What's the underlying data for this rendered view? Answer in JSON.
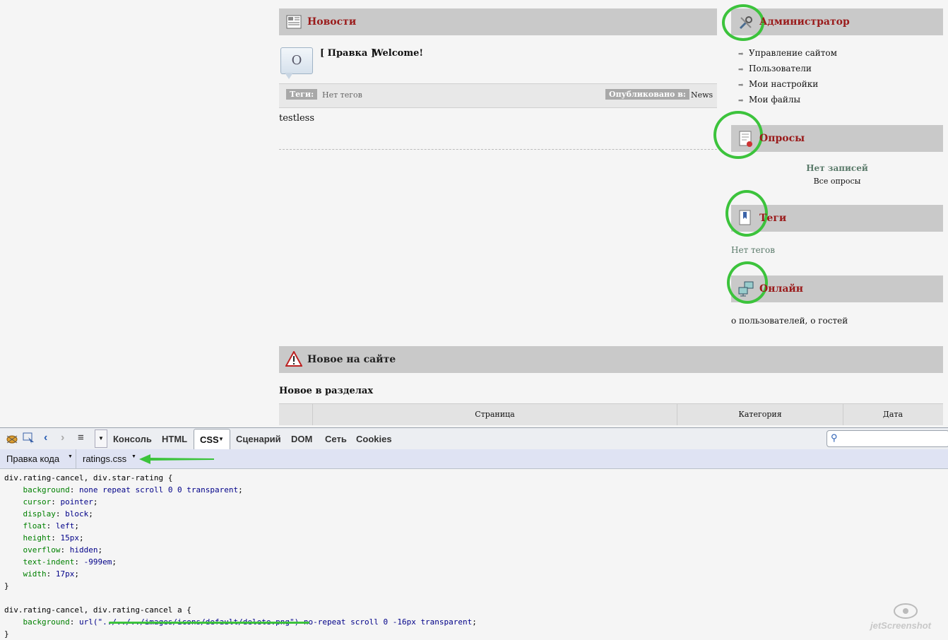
{
  "news": {
    "title": "Новости",
    "avatar_letter": "O",
    "edit_label": "[ Правка ]",
    "post_title": "Welcome!",
    "tags_label": "Теги:",
    "tags_value": "Нет тегов",
    "published_label": "Опубликовано в:",
    "published_value": "News",
    "body": "testless"
  },
  "admin": {
    "title": "Администратор",
    "links": [
      "Управление сайтом",
      "Пользователи",
      "Мои настройки",
      "Мои файлы"
    ]
  },
  "polls": {
    "title": "Опросы",
    "empty": "Нет записей",
    "all": "Все опросы"
  },
  "tags": {
    "title": "Теги",
    "empty": "Нет тегов"
  },
  "online": {
    "title": "Онлайн",
    "text": "о пользователей, о гостей"
  },
  "new_on_site": {
    "title": "Новое на сайте",
    "subtitle": "Новое в разделах",
    "columns": [
      "Страница",
      "Категория",
      "Дата"
    ]
  },
  "firebug": {
    "tabs": [
      "Консоль",
      "HTML",
      "CSS",
      "Сценарий",
      "DOM",
      "Сеть",
      "Cookies"
    ],
    "active_tab": "CSS",
    "edit_mode": "Правка кода",
    "stylesheet": "ratings.css",
    "search_placeholder": ""
  },
  "css_code": {
    "rule1_selector": "div.rating-cancel, div.star-rating {",
    "rule1": [
      {
        "p": "background",
        "v": "none repeat scroll 0 0 transparent"
      },
      {
        "p": "cursor",
        "v": "pointer"
      },
      {
        "p": "display",
        "v": "block"
      },
      {
        "p": "float",
        "v": "left"
      },
      {
        "p": "height",
        "v": "15px"
      },
      {
        "p": "overflow",
        "v": "hidden"
      },
      {
        "p": "text-indent",
        "v": "-999em"
      },
      {
        "p": "width",
        "v": "17px"
      }
    ],
    "close": "}",
    "rule2_selector": "div.rating-cancel, div.rating-cancel a {",
    "rule2_prop": "background",
    "rule2_url": "url(\"../../../images/icons/default/delete.png\")",
    "rule2_rest": "no-repeat scroll 0 -16px transparent"
  },
  "watermark": "jetScreenshot",
  "colors": {
    "accent_red": "#9a1b1b",
    "highlight_green": "#3cc33c",
    "bar_gray": "#c9c9c9"
  }
}
